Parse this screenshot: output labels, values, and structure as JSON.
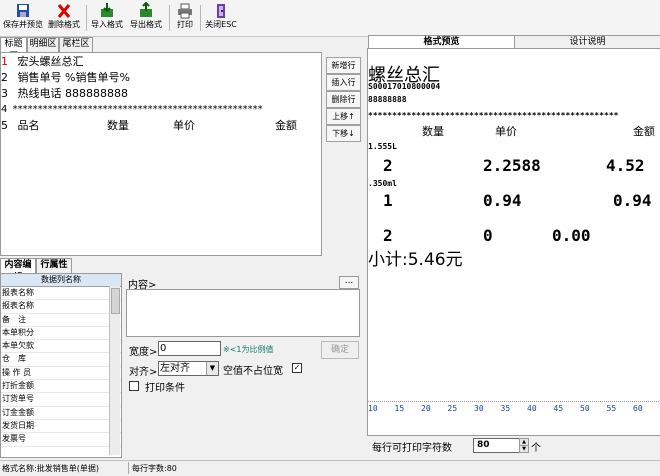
{
  "toolbar": {
    "save": "保存并预览",
    "delete": "删除格式",
    "import": "导入格式",
    "export": "导出格式",
    "print": "打印",
    "close": "关闭ESC"
  },
  "left_tabs": [
    "标题区",
    "明细区",
    "尾栏区"
  ],
  "editor": {
    "lines": [
      {
        "num": "1",
        "text": "宏头螺丝总汇"
      },
      {
        "num": "2",
        "text": "销售单号 %销售单号%"
      },
      {
        "num": "3",
        "text": "热线电话 888888888"
      },
      {
        "num": "4",
        "text": "**************************************************"
      },
      {
        "num": "5",
        "text": "品名"
      }
    ],
    "line5_cols": [
      "数量",
      "单价",
      "金额"
    ]
  },
  "side_buttons": [
    "新增行",
    "插入行",
    "删除行",
    "上移↑",
    "下移↓"
  ],
  "bottom_tabs": [
    "内容编辑",
    "行属性"
  ],
  "field_list": {
    "header": "数据列名称",
    "items": [
      "报表名称",
      "报表名称",
      "备　注",
      "本单积分",
      "本单欠款",
      "仓　库",
      "操 作 员",
      "打折金额",
      "订货单号",
      "订金金额",
      "发货日期",
      "发票号"
    ]
  },
  "props": {
    "content_label": "内容>",
    "more_button": "...",
    "width_label": "宽度>",
    "width_value": "0",
    "width_hint": "※<1为比例值",
    "confirm": "确定",
    "align_label": "对齐>",
    "align_value": "左对齐",
    "blank_label": "空值不占位宽",
    "print_condition": "打印条件"
  },
  "right_tabs": [
    "格式预览",
    "设计说明"
  ],
  "preview": {
    "title": "螺丝总汇",
    "order_no": "S00017010800004",
    "phone": "88888888",
    "stars": "****************************************************",
    "col_qty": "数量",
    "col_price": "单价",
    "col_amount": "金额",
    "item1_name": "1.555L",
    "item1_qty": "2",
    "item1_price": "2.2588",
    "item1_amount": "4.52",
    "item2_name": ".350ml",
    "item2_qty": "1",
    "item2_price": "0.94",
    "item2_amount": "0.94",
    "item3_qty": "2",
    "item3_price": "0",
    "item3_amount": "0.00",
    "subtotal": "小计:5.46元"
  },
  "ruler_ticks": [
    "10",
    "15",
    "20",
    "25",
    "30",
    "35",
    "40",
    "45",
    "50",
    "55",
    "60"
  ],
  "chars_per_line": {
    "label": "每行可打印字符数",
    "value": "80",
    "unit": "个"
  },
  "status": {
    "format_name": "格式名称:批发销售单(单据)",
    "char_count": "每行字数:80"
  }
}
